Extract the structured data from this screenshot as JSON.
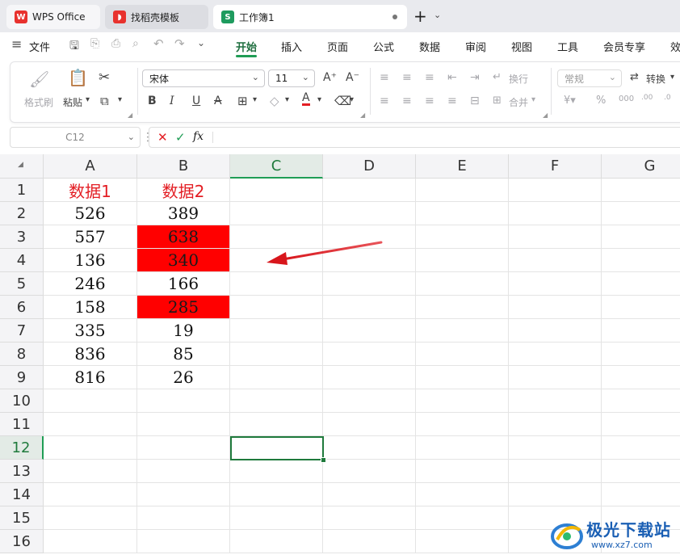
{
  "tabs": [
    {
      "label": "WPS Office",
      "icon": "wps-logo-icon"
    },
    {
      "label": "找稻壳模板",
      "icon": "daoke-icon"
    },
    {
      "label": "工作簿1",
      "icon": "spreadsheet-icon"
    }
  ],
  "menu": {
    "file": "文件",
    "items": [
      "开始",
      "插入",
      "页面",
      "公式",
      "数据",
      "审阅",
      "视图",
      "工具",
      "会员专享",
      "效"
    ]
  },
  "ribbon": {
    "format_painter": "格式刷",
    "paste": "粘贴",
    "font_name": "宋体",
    "font_size": "11",
    "wrap": "换行",
    "merge": "合并",
    "number_format": "常规",
    "convert": "转换"
  },
  "formula_bar": {
    "name_box": "C12",
    "fx": "fx",
    "content": ""
  },
  "sheet": {
    "columns": [
      "A",
      "B",
      "C",
      "D",
      "E",
      "F",
      "G"
    ],
    "rows": [
      "1",
      "2",
      "3",
      "4",
      "5",
      "6",
      "7",
      "8",
      "9",
      "10",
      "11",
      "12",
      "13",
      "14",
      "15",
      "16"
    ],
    "active_row": "12",
    "active_column": "C",
    "data": [
      [
        "数据1",
        "数据2"
      ],
      [
        "526",
        "389"
      ],
      [
        "557",
        "638"
      ],
      [
        "136",
        "340"
      ],
      [
        "246",
        "166"
      ],
      [
        "158",
        "285"
      ],
      [
        "335",
        "19"
      ],
      [
        "836",
        "85"
      ],
      [
        "816",
        "26"
      ]
    ],
    "highlight_color": "#ff0000",
    "header_text_color": "#e31e24"
  },
  "watermark": {
    "title": "极光下载站",
    "url": "www.xz7.com"
  }
}
